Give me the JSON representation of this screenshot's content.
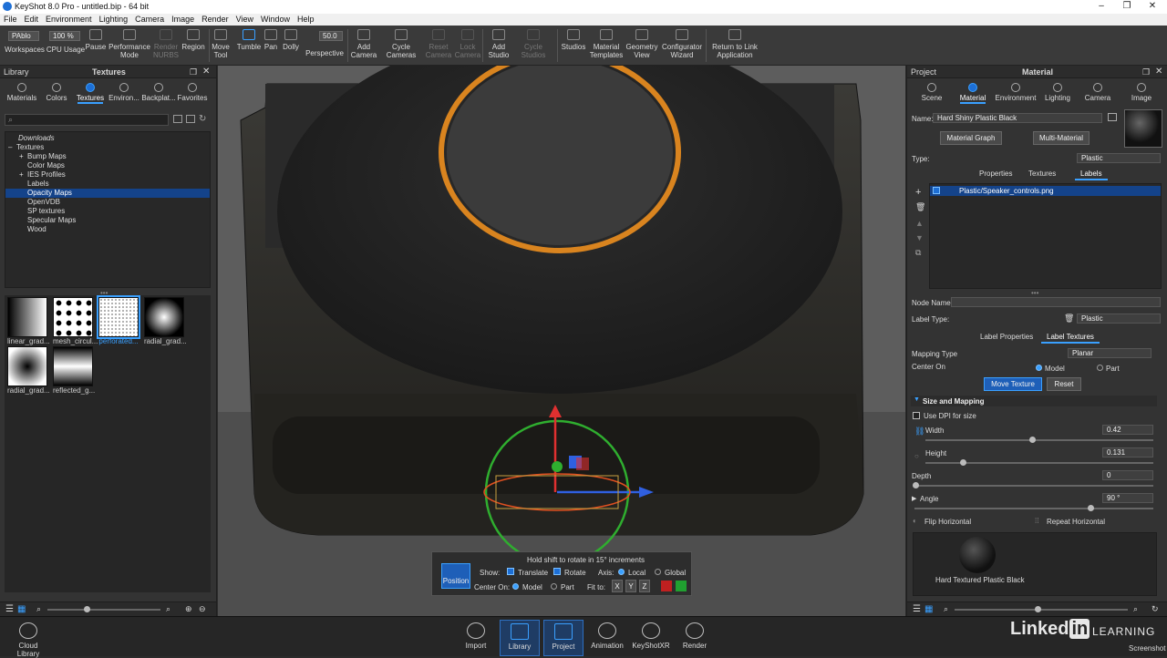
{
  "window": {
    "title": "KeyShot 8.0 Pro - untitled.bip - 64 bit",
    "minimize": "–",
    "restore": "❐",
    "close": "✕"
  },
  "menu": [
    "File",
    "Edit",
    "Environment",
    "Lighting",
    "Camera",
    "Image",
    "Render",
    "View",
    "Window",
    "Help"
  ],
  "toolbar": {
    "workspace_value": "PAblo",
    "cpu_value": "100 %",
    "fov_value": "50.0",
    "items": [
      "Workspaces",
      "CPU Usage",
      "Pause",
      "Performance Mode",
      "Render NURBS",
      "Region",
      "Move Tool",
      "Tumble",
      "Pan",
      "Dolly",
      "Perspective",
      "Add Camera",
      "Cycle Cameras",
      "Reset Camera",
      "Lock Camera",
      "Add Studio",
      "Cycle Studios",
      "Studios",
      "Material Templates",
      "Geometry View",
      "Configurator Wizard",
      "Return to Link Application"
    ]
  },
  "library": {
    "panel_label": "Library",
    "title": "Textures",
    "tabs": [
      "Materials",
      "Colors",
      "Textures",
      "Environ...",
      "Backplat...",
      "Favorites"
    ],
    "tree": {
      "downloads": "Downloads",
      "textures": "Textures",
      "items": [
        "Bump Maps",
        "Color Maps",
        "IES Profiles",
        "Labels",
        "Opacity Maps",
        "OpenVDB",
        "SP textures",
        "Specular Maps",
        "Wood"
      ]
    },
    "thumbs": [
      "linear_grad...",
      "mesh_circul...",
      "perforated...",
      "radial_grad...",
      "radial_grad...",
      "reflected_g..."
    ],
    "cloud": "Cloud Library"
  },
  "overlay": {
    "hint": "Hold shift to rotate in 15° increments",
    "position": "Position",
    "show": "Show:",
    "translate": "Translate",
    "rotate": "Rotate",
    "axis": "Axis:",
    "local": "Local",
    "global": "Global",
    "center_on": "Center On:",
    "model": "Model",
    "part": "Part",
    "fit_to": "Fit to:",
    "x": "X",
    "y": "Y",
    "z": "Z"
  },
  "project": {
    "panel_label": "Project",
    "title": "Material",
    "tabs": [
      "Scene",
      "Material",
      "Environment",
      "Lighting",
      "Camera",
      "Image"
    ],
    "name_label": "Name:",
    "name_value": "Hard Shiny Plastic Black",
    "material_graph": "Material Graph",
    "multi_material": "Multi-Material",
    "type_label": "Type:",
    "type_value": "Plastic",
    "subtabs": [
      "Properties",
      "Textures",
      "Labels"
    ],
    "label_item": "Plastic/Speaker_controls.png",
    "node_name_label": "Node Name:",
    "label_type_label": "Label Type:",
    "label_type_value": "Plastic",
    "label_tabs": [
      "Label Properties",
      "Label Textures"
    ],
    "mapping_type_label": "Mapping Type",
    "mapping_type_value": "Planar",
    "center_on_label": "Center On",
    "model": "Model",
    "part": "Part",
    "move_texture": "Move Texture",
    "reset": "Reset",
    "size_mapping": "Size and Mapping",
    "use_dpi": "Use DPI for size",
    "width_label": "Width",
    "width_value": "0.42",
    "height_label": "Height",
    "height_value": "0.131",
    "depth_label": "Depth",
    "depth_value": "0",
    "angle_label": "Angle",
    "angle_value": "90 °",
    "flip_h": "Flip Horizontal",
    "repeat_h": "Repeat Horizontal",
    "preview_label": "Hard Textured Plastic Black"
  },
  "bottom": {
    "items": [
      "Import",
      "Library",
      "Project",
      "Animation",
      "KeyShotXR",
      "Render"
    ],
    "brand": "Linked",
    "brand_in": "in",
    "learning": "LEARNING",
    "screenshot": "Screenshot"
  }
}
